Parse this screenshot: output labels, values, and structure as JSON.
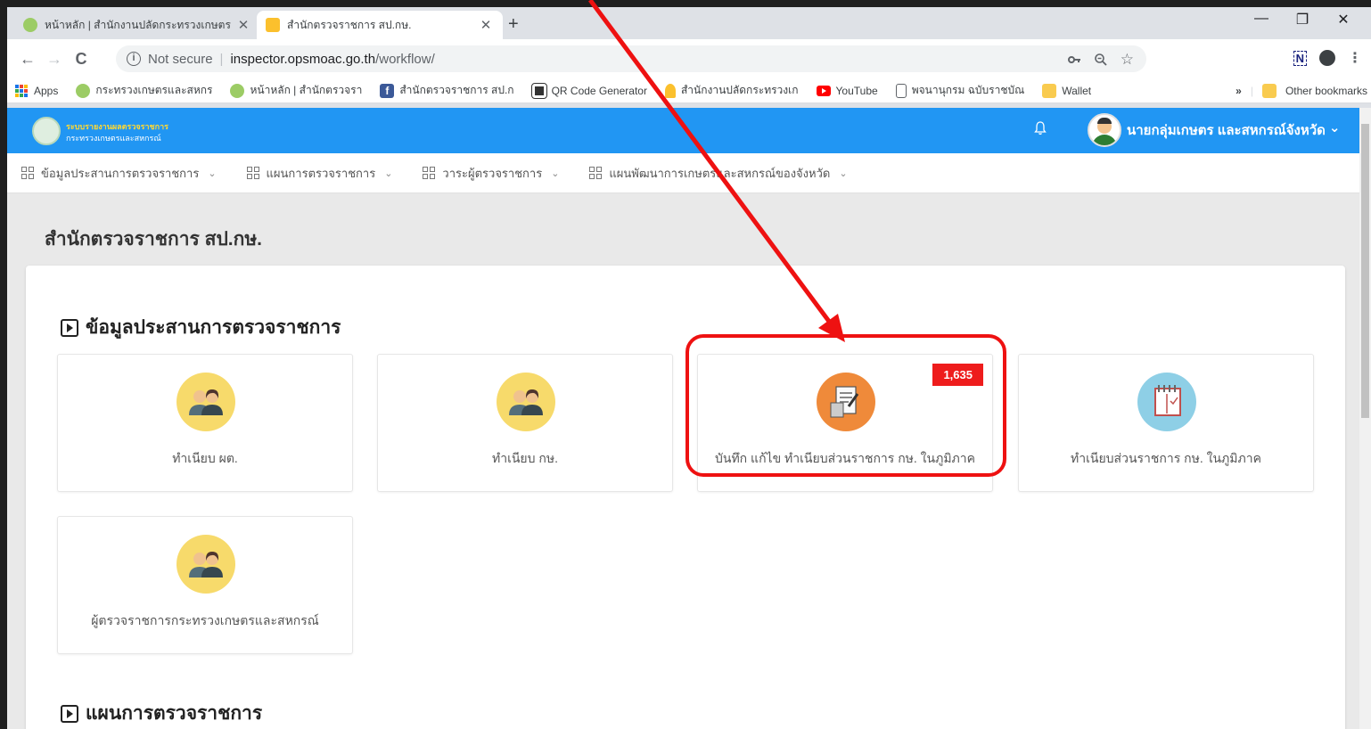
{
  "tabs": [
    {
      "title": "หน้าหลัก | สำนักงานปลัดกระทรวงเกษตร",
      "close": "✕"
    },
    {
      "title": "สำนักตรวจราชการ สป.กษ.",
      "close": "✕"
    }
  ],
  "new_tab": "+",
  "window_controls": {
    "minimize": "—",
    "restore": "❐",
    "close": "✕"
  },
  "toolbar": {
    "back": "←",
    "forward": "→",
    "reload": "C",
    "info": "i",
    "security": "Not secure",
    "url_host": "inspector.opsmoac.go.th",
    "url_path": "/workflow/"
  },
  "bookmarks": [
    {
      "label": "Apps",
      "icon": "apps-grid-icon",
      "color": "#1a73e8"
    },
    {
      "label": "กระทรวงเกษตรและสหกร",
      "icon": "moac-logo-icon",
      "color": "#7cb342"
    },
    {
      "label": "หน้าหลัก | สำนักตรวจรา",
      "icon": "moac-logo-icon",
      "color": "#7cb342"
    },
    {
      "label": "สำนักตรวจราชการ สป.ก",
      "icon": "facebook-icon",
      "color": "#3b5998"
    },
    {
      "label": "QR Code Generator",
      "icon": "qr-code-icon",
      "color": "#333333"
    },
    {
      "label": "สำนักงานปลัดกระทรวงเก",
      "icon": "lamp-icon",
      "color": "#fbc02d"
    },
    {
      "label": "YouTube",
      "icon": "youtube-icon",
      "color": "#ff0000"
    },
    {
      "label": "พจนานุกรม ฉบับราชบัณ",
      "icon": "page-icon",
      "color": "#ffffff"
    },
    {
      "label": "Wallet",
      "icon": "folder-icon",
      "color": "#f9cb4f"
    }
  ],
  "bookmarks_more": "»",
  "other_bookmarks": "Other bookmarks",
  "app": {
    "logo_line1": "ระบบรายงานผลตรวจราชการ",
    "logo_line2": "กระทรวงเกษตรและสหกรณ์",
    "user_name": "นายกลุ่มเกษตร และสหกรณ์จังหวัด",
    "user_caret": "⌄",
    "menu": [
      {
        "label": "ข้อมูลประสานการตรวจราชการ"
      },
      {
        "label": "แผนการตรวจราชการ"
      },
      {
        "label": "วาระผู้ตรวจราชการ"
      },
      {
        "label": "แผนพัฒนาการเกษตรและสหกรณ์ของจังหวัด"
      }
    ],
    "menu_chevron": "⌄",
    "page_title": "สำนักตรวจราชการ สป.กษ.",
    "section1_title": "ข้อมูลประสานการตรวจราชการ",
    "section2_title": "แผนการตรวจราชการ",
    "tiles": [
      {
        "label": "ทำเนียบ ผต.",
        "icon": "people-icon",
        "color": "#f7da6b"
      },
      {
        "label": "ทำเนียบ กษ.",
        "icon": "people-icon",
        "color": "#f7da6b"
      },
      {
        "label": "บันทึก แก้ไข ทำเนียบส่วนราชการ กษ. ในภูมิภาค",
        "icon": "edit-document-icon",
        "color": "#ef8a3a",
        "badge": "1,635"
      },
      {
        "label": "ทำเนียบส่วนราชการ กษ. ในภูมิภาค",
        "icon": "notebook-icon",
        "color": "#8ecfe6"
      },
      {
        "label": "ผู้ตรวจราชการกระทรวงเกษตรและสหกรณ์",
        "icon": "people-icon",
        "color": "#f7da6b"
      }
    ]
  },
  "annotation": {
    "color": "#ee1111"
  }
}
